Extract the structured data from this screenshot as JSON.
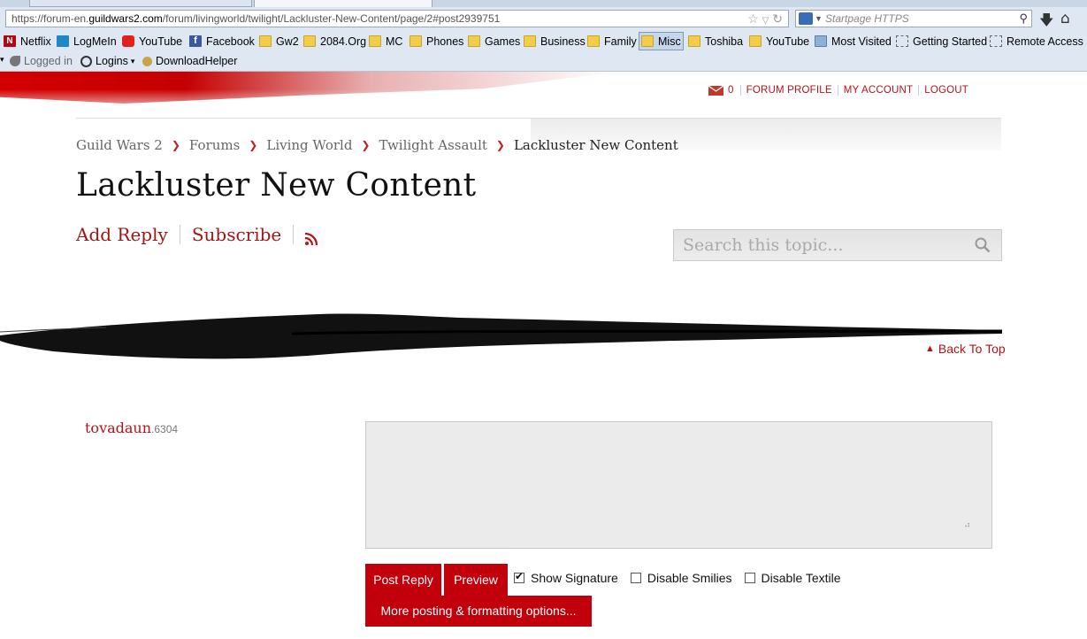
{
  "browser": {
    "url_prefix": "https://forum-en.",
    "url_domain": "guildwars2.com",
    "url_path": "/forum/livingworld/twilight/Lackluster-New-Content/page/2#post2939751",
    "search_placeholder": "Startpage HTTPS"
  },
  "bookmarks": [
    {
      "label": "Netflix",
      "icon": "netflix-icon"
    },
    {
      "label": "LogMeIn",
      "icon": "logmein-icon"
    },
    {
      "label": "YouTube",
      "icon": "youtube-icon"
    },
    {
      "label": "Facebook",
      "icon": "facebook-icon"
    },
    {
      "label": "Gw2",
      "icon": "folder-icon"
    },
    {
      "label": "2084.Org",
      "icon": "folder-icon"
    },
    {
      "label": "MC",
      "icon": "folder-icon"
    },
    {
      "label": "Phones",
      "icon": "folder-icon"
    },
    {
      "label": "Games",
      "icon": "folder-icon"
    },
    {
      "label": "Business",
      "icon": "folder-icon"
    },
    {
      "label": "Family",
      "icon": "folder-icon"
    },
    {
      "label": "Misc",
      "icon": "folder-icon"
    },
    {
      "label": "Toshiba",
      "icon": "folder-icon"
    },
    {
      "label": "YouTube",
      "icon": "folder-icon"
    },
    {
      "label": "Most Visited",
      "icon": "most-visited-icon"
    },
    {
      "label": "Getting Started",
      "icon": "bookmark-icon"
    },
    {
      "label": "Remote Access a",
      "icon": "bookmark-icon"
    }
  ],
  "addons": {
    "logged_in": "Logged in",
    "logins": "Logins",
    "downloadhelper": "DownloadHelper"
  },
  "usernav": {
    "message_count": "0",
    "forum_profile": "FORUM PROFILE",
    "my_account": "MY ACCOUNT",
    "logout": "LOGOUT"
  },
  "breadcrumb": [
    "Guild Wars 2",
    "Forums",
    "Living World",
    "Twilight Assault",
    "Lackluster New Content"
  ],
  "thread": {
    "title": "Lackluster New Content",
    "add_reply": "Add Reply",
    "subscribe": "Subscribe"
  },
  "topic_search": {
    "placeholder": "Search this topic..."
  },
  "back_to_top": "Back To Top",
  "reply": {
    "author": "tovadaun",
    "author_id": ".6304",
    "textarea_value": "",
    "post_reply": "Post Reply",
    "preview": "Preview",
    "show_signature": "Show Signature",
    "show_signature_checked": true,
    "disable_smilies": "Disable Smilies",
    "disable_smilies_checked": false,
    "disable_textile": "Disable Textile",
    "disable_textile_checked": false,
    "more_options": "More posting & formatting options..."
  },
  "colors": {
    "accent_red": "#b5121b",
    "button_red": "#c1000b"
  }
}
